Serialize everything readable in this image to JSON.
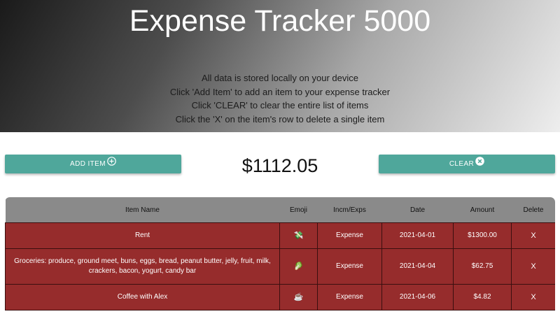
{
  "header": {
    "title": "Expense Tracker 5000",
    "instructions": [
      "All data is stored locally on your device",
      "Click 'Add Item' to add an item to your expense tracker",
      "Click 'CLEAR' to clear the entire list of items",
      "Click the 'X' on the item's row to delete a single item"
    ]
  },
  "controls": {
    "add_label": "ADD ITEM",
    "clear_label": "CLEAR",
    "total": "$1112.05",
    "accent": "#4fa79b"
  },
  "table": {
    "columns": [
      "Item Name",
      "Emoji",
      "Incm/Exps",
      "Date",
      "Amount",
      "Delete"
    ],
    "rows": [
      {
        "name": "Rent",
        "emoji": "💸",
        "type": "Expense",
        "date": "2021-04-01",
        "amount": "$1300.00",
        "delete": "X"
      },
      {
        "name": "Groceries: produce, ground meet, buns, eggs, bread, peanut butter, jelly, fruit, milk, crackers, bacon, yogurt, candy bar",
        "emoji": "🥬",
        "type": "Expense",
        "date": "2021-04-04",
        "amount": "$62.75",
        "delete": "X"
      },
      {
        "name": "Coffee with Alex",
        "emoji": "☕",
        "type": "Expense",
        "date": "2021-04-06",
        "amount": "$4.82",
        "delete": "X"
      }
    ],
    "row_color": "#962c2c",
    "header_color": "#8a8a8a"
  }
}
